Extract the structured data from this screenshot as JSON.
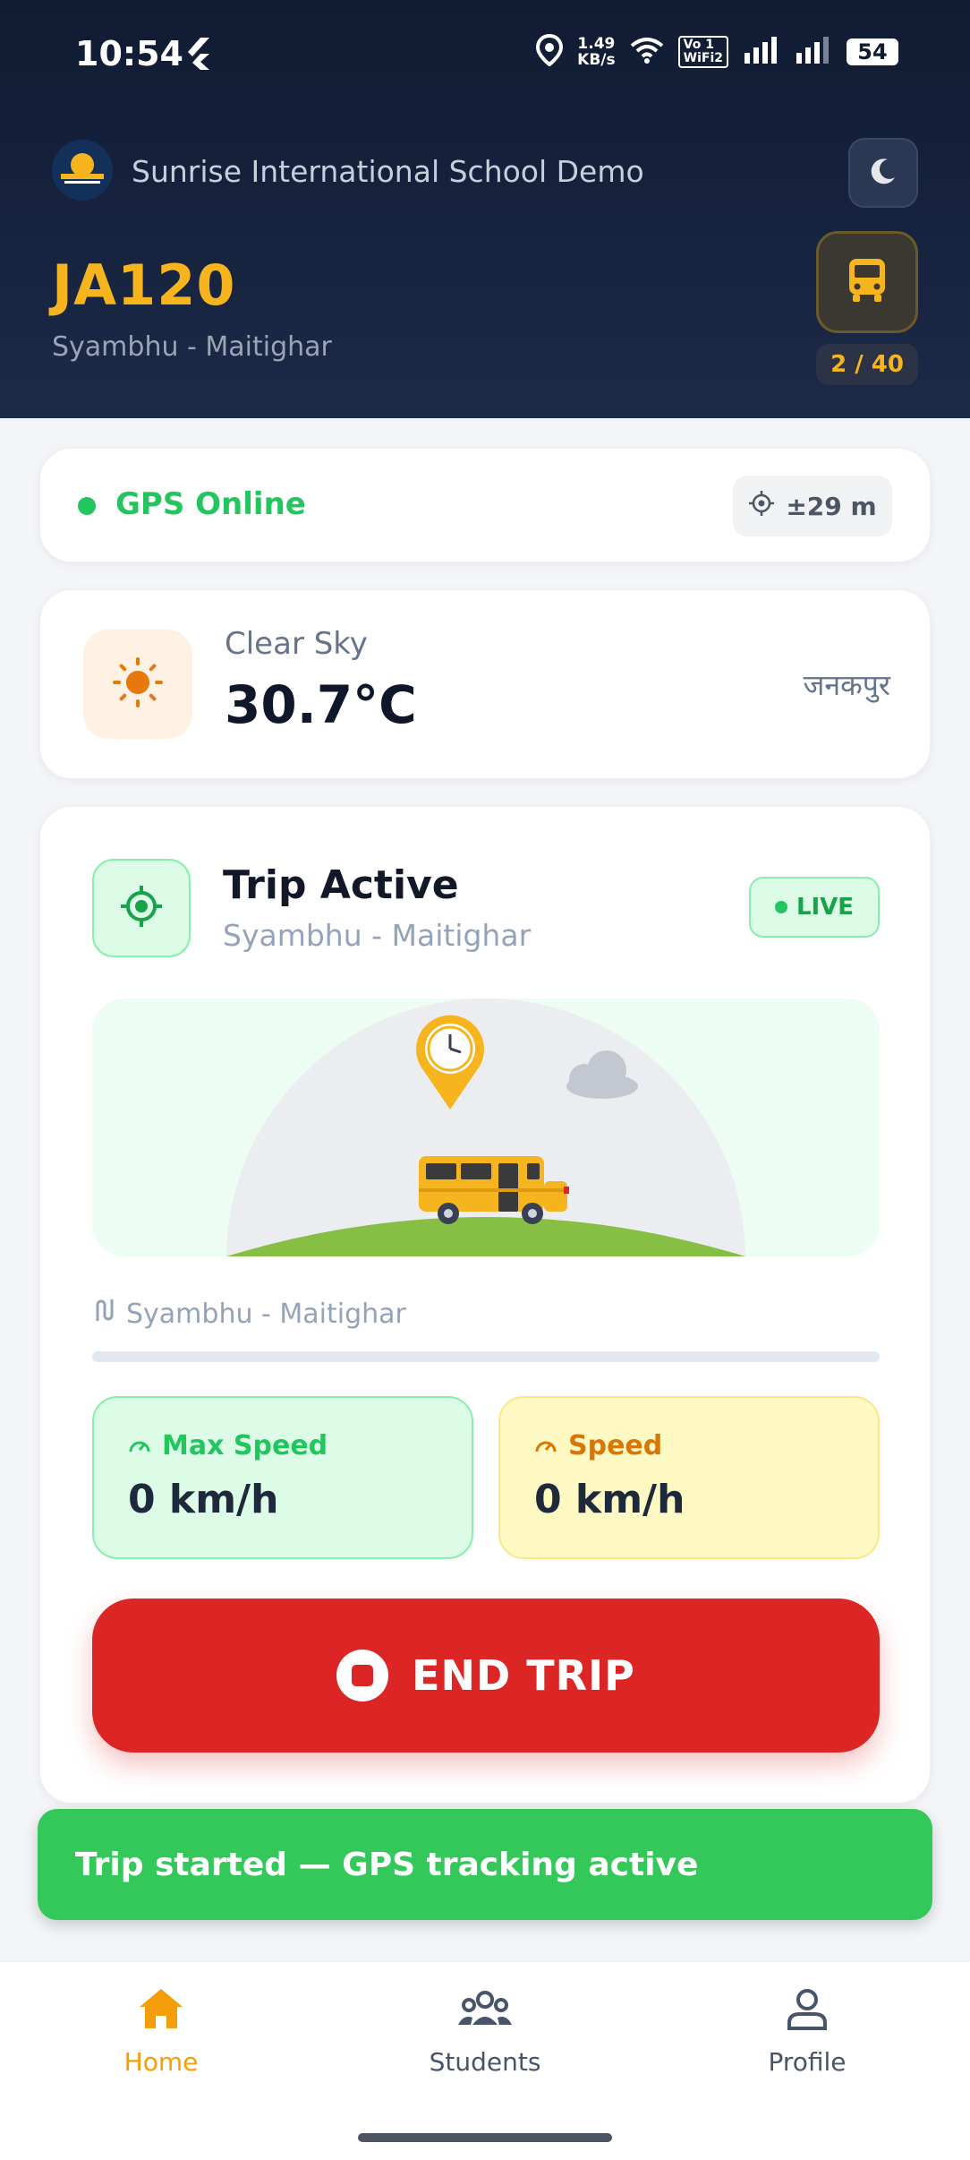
{
  "status_bar": {
    "time": "10:54",
    "net_speed_value": "1.49",
    "net_speed_unit": "KB/s",
    "volte_top": "Vo 1",
    "volte_bottom": "WiFi2",
    "battery": "54"
  },
  "header": {
    "school_name": "Sunrise International School Demo",
    "bus_code": "JA120",
    "route": "Syambhu - Maitighar",
    "capacity": "2 / 40",
    "accent_color": "#f6b51e"
  },
  "gps": {
    "status": "GPS Online",
    "accuracy": "±29 m",
    "status_color": "#22c55e"
  },
  "weather": {
    "condition": "Clear Sky",
    "temperature": "30.7°C",
    "location": "जनकपुर"
  },
  "trip": {
    "title": "Trip Active",
    "route": "Syambhu - Maitighar",
    "live_label": "LIVE",
    "route_line": "Syambhu - Maitighar",
    "progress_fraction": 0,
    "max_speed_label": "Max Speed",
    "max_speed_value": "0 km/h",
    "speed_label": "Speed",
    "speed_value": "0 km/h",
    "end_button": "END TRIP",
    "end_button_color": "#dc2626"
  },
  "snackbar": {
    "message": "Trip started — GPS tracking active"
  },
  "bottom_nav": {
    "items": [
      {
        "label": "Home",
        "icon": "home-icon",
        "active": true
      },
      {
        "label": "Students",
        "icon": "students-icon",
        "active": false
      },
      {
        "label": "Profile",
        "icon": "profile-icon",
        "active": false
      }
    ]
  }
}
